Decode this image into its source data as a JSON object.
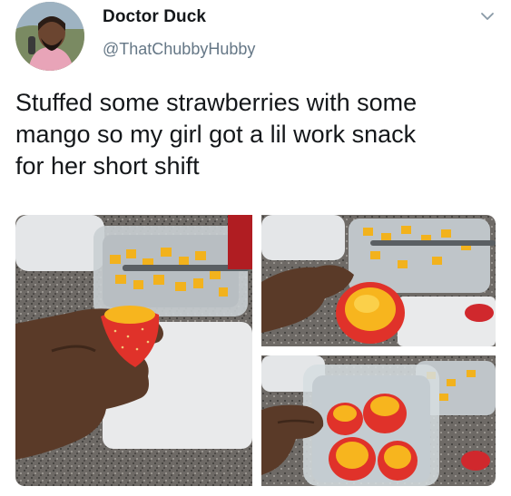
{
  "tweet": {
    "author": {
      "display_name": "Doctor Duck",
      "handle": "@ThatChubbyHubby",
      "avatar_icon": "profile-photo"
    },
    "menu_icon": "chevron-down-icon",
    "text_lines": [
      "Stuffed some strawberries with some",
      "mango so my girl got a lil work snack",
      "for her short shift"
    ],
    "media": [
      {
        "name": "photo-hand-holding-stuffed-strawberry",
        "alt": ""
      },
      {
        "name": "photo-closeup-stuffed-strawberry",
        "alt": ""
      },
      {
        "name": "photo-container-of-stuffed-strawberries",
        "alt": ""
      }
    ]
  },
  "colors": {
    "text": "#14171a",
    "secondary_text": "#657786",
    "strawberry": "#e0322a",
    "mango": "#f7b51e"
  }
}
